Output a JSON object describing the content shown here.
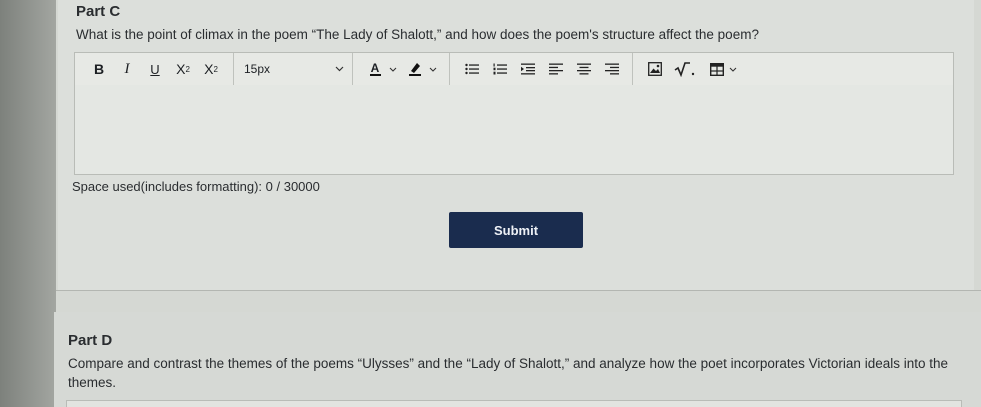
{
  "part_c": {
    "title": "Part C",
    "question": "What is the point of climax in the poem “The Lady of Shalott,” and how does the poem's structure affect the poem?",
    "toolbar": {
      "bold_label": "B",
      "italic_label": "I",
      "underline_label": "U",
      "superscript_label": "X",
      "superscript_mark": "2",
      "subscript_label": "X",
      "subscript_mark": "2",
      "font_size": "15px",
      "font_color_label": "A"
    },
    "editor_value": "",
    "space_used": "Space used(includes formatting): 0 / 30000",
    "submit_label": "Submit"
  },
  "part_d": {
    "title": "Part D",
    "question": "Compare and contrast the themes of the poems “Ulysses” and the “Lady of Shalott,” and analyze how the poet incorporates Victorian ideals into the themes."
  },
  "colors": {
    "submit_bg": "#1a2c4e",
    "page_bg": "#d5d8d3"
  }
}
